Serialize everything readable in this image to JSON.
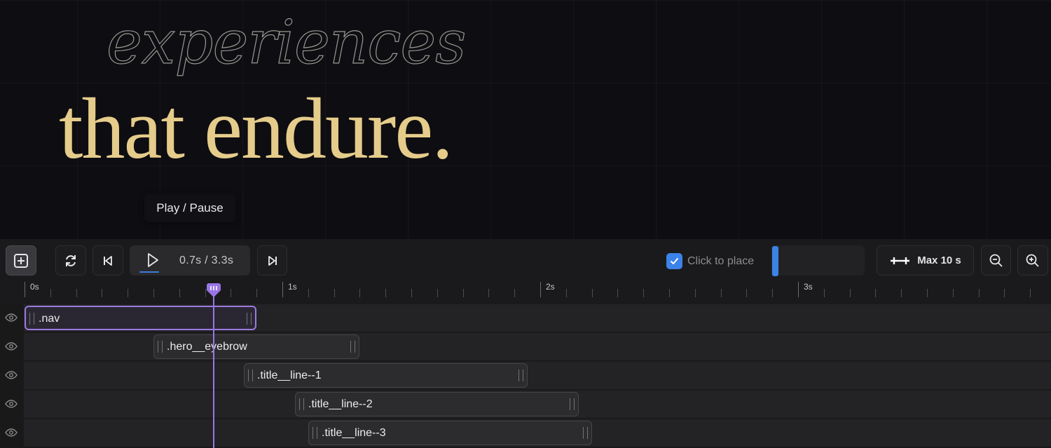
{
  "preview": {
    "eyebrow_text": "experiences",
    "headline_text": "that endure.",
    "tooltip": "Play / Pause",
    "colors": {
      "headline": "#e5cc8b",
      "background": "#0e0d11"
    }
  },
  "toolbar": {
    "add_icon": "plus-square-icon",
    "loop_icon": "loop-icon",
    "skip_back_icon": "skip-to-start-icon",
    "play_icon": "play-icon",
    "time_readout": "0.7s / 3.3s",
    "skip_forward_icon": "skip-to-end-icon",
    "click_to_place_label": "Click to place",
    "click_to_place_checked": true,
    "max_label": "Max 10 s",
    "zoom_out_icon": "zoom-out-icon",
    "zoom_in_icon": "zoom-in-icon",
    "accent": "#3b83e8"
  },
  "timeline": {
    "ruler_labels": [
      "0s",
      "1s",
      "2s",
      "3s"
    ],
    "playhead_time": "0.7s",
    "tracks": [
      {
        "label": ".nav",
        "start": 0.0,
        "end": 0.9,
        "selected": true
      },
      {
        "label": ".hero__eyebrow",
        "start": 0.5,
        "end": 1.3,
        "selected": false
      },
      {
        "label": ".title__line--1",
        "start": 0.85,
        "end": 1.95,
        "selected": false
      },
      {
        "label": ".title__line--2",
        "start": 1.05,
        "end": 2.15,
        "selected": false
      },
      {
        "label": ".title__line--3",
        "start": 1.1,
        "end": 2.2,
        "selected": false
      }
    ],
    "accent": "#9a75e6"
  }
}
